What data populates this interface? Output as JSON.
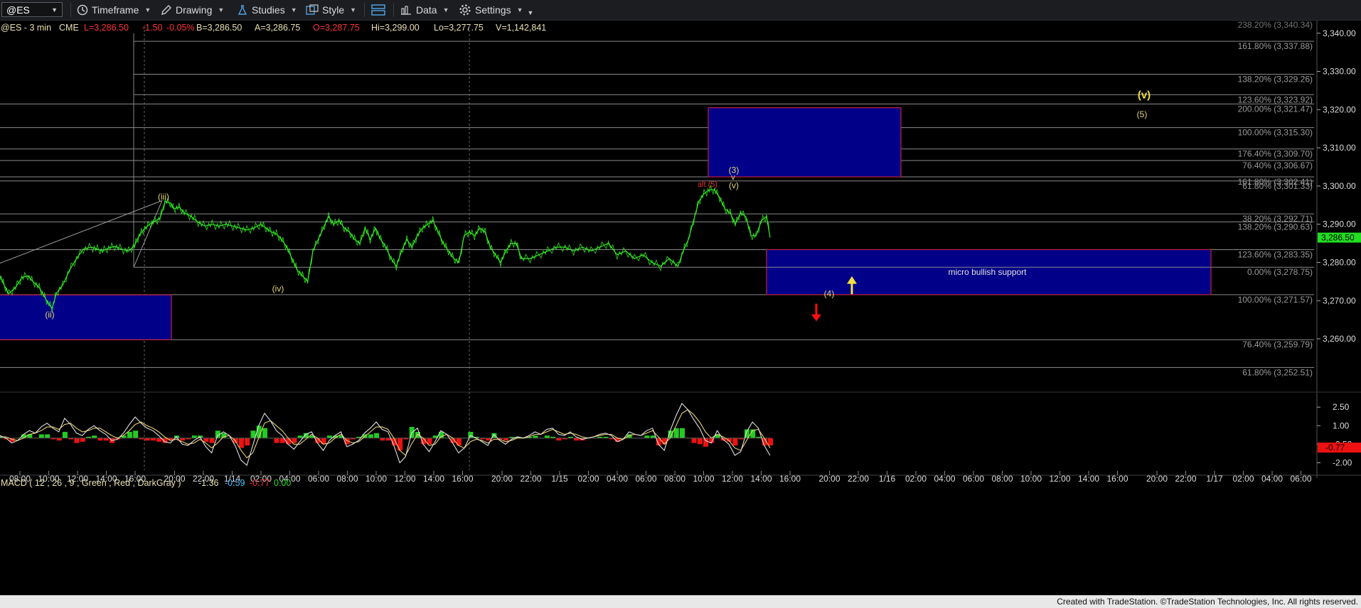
{
  "toolbar": {
    "symbol": "@ES",
    "timeframe_label": "Timeframe",
    "drawing_label": "Drawing",
    "studies_label": "Studies",
    "style_label": "Style",
    "data_label": "Data",
    "settings_label": "Settings"
  },
  "footer": {
    "text": "Created with TradeStation. ©TradeStation Technologies, Inc. All rights reserved."
  },
  "colors": {
    "price": "#33ee22",
    "box_fill": "#000088",
    "box_border": "#c02040",
    "label_yellow": "#e8d870",
    "label_bright_yellow": "#f0e040",
    "arrow_red": "#ff1010",
    "macd_line": "#e0e0e0",
    "signal_line": "#e8d070",
    "hist_up": "#22cc22",
    "hist_down": "#ee1111"
  },
  "chart_data": [
    {
      "type": "line",
      "header": {
        "title": "@ES - 3 min",
        "exchange": "CME",
        "last": "L=3,286.50",
        "change": "-1.50",
        "pct": "-0.05%",
        "bid": "B=3,286.50",
        "ask": "A=3,286.75",
        "open": "O=3,287.75",
        "high": "Hi=3,299.00",
        "low": "Lo=3,277.75",
        "volume": "V=1,142,841"
      },
      "ylim": [
        3247,
        3342
      ],
      "y_ticks": [
        3340,
        3330,
        3320,
        3310,
        3300,
        3290,
        3280,
        3270,
        3260
      ],
      "y_tick_labels": [
        "3,340.00",
        "3,330.00",
        "3,320.00",
        "3,310.00",
        "3,300.00",
        "3,290.00",
        "3,280.00",
        "3,270.00",
        "3,260.00"
      ],
      "last_price": 3286.5,
      "last_price_label": "3,286.50",
      "x_tick_labels": [
        "08:00",
        "10:00",
        "12:00",
        "14:00",
        "16:00",
        "20:00",
        "22:00",
        "1/14",
        "02:00",
        "04:00",
        "06:00",
        "08:00",
        "10:00",
        "12:00",
        "14:00",
        "16:00",
        "20:00",
        "22:00",
        "1/15",
        "02:00",
        "04:00",
        "06:00",
        "08:00",
        "10:00",
        "12:00",
        "14:00",
        "16:00",
        "20:00",
        "22:00",
        "1/16",
        "02:00",
        "04:00",
        "06:00",
        "08:00",
        "10:00",
        "12:00",
        "14:00",
        "16:00",
        "20:00",
        "22:00",
        "1/17",
        "02:00",
        "04:00",
        "06:00"
      ],
      "price_series": {
        "name": "",
        "x": [
          0,
          5,
          10,
          18,
          25,
          32,
          38,
          45,
          50,
          55,
          60,
          65,
          72,
          80,
          88,
          96,
          105,
          112,
          118,
          125,
          132,
          140,
          148,
          155,
          160,
          165,
          172,
          178,
          184,
          190,
          196,
          200,
          206,
          212,
          220,
          228,
          236,
          244,
          252,
          260,
          268,
          276,
          284,
          292,
          300,
          306,
          312,
          318,
          324,
          330,
          336,
          342,
          348,
          354,
          360,
          366,
          372,
          378,
          384,
          390,
          396,
          402,
          408,
          414,
          420,
          426,
          432,
          438,
          444,
          450,
          456,
          462,
          468,
          474,
          480,
          486,
          492,
          498,
          504,
          510,
          516,
          522,
          528,
          534,
          540,
          546,
          552,
          558,
          564,
          570,
          576,
          582,
          588,
          594,
          600,
          610,
          620,
          630,
          640,
          650,
          660,
          670,
          680,
          690,
          700,
          710,
          720,
          730,
          740,
          750,
          760,
          770,
          780,
          786,
          792,
          798,
          804,
          810,
          816,
          822,
          828,
          834,
          840,
          846,
          852,
          858,
          864,
          870,
          876,
          882,
          886
        ],
        "values": [
          3276.5,
          3274,
          3271.8,
          3273.5,
          3276,
          3276.5,
          3275,
          3273.5,
          3271.5,
          3269.5,
          3268,
          3272,
          3274,
          3278,
          3281,
          3283.5,
          3284,
          3283.5,
          3283,
          3283.8,
          3284.2,
          3283.5,
          3283,
          3284.5,
          3287,
          3288.5,
          3290,
          3290.8,
          3291.5,
          3296,
          3295.5,
          3294,
          3294.5,
          3293,
          3292,
          3290.5,
          3289.5,
          3290,
          3289.5,
          3290,
          3289.5,
          3289,
          3288.5,
          3289,
          3290,
          3289,
          3288,
          3287.5,
          3286,
          3284,
          3281,
          3278,
          3276.5,
          3275,
          3283,
          3286,
          3289,
          3292,
          3290,
          3291,
          3289,
          3288,
          3286,
          3285,
          3289,
          3286,
          3289,
          3286,
          3284,
          3281,
          3279,
          3283,
          3286,
          3284,
          3287,
          3289,
          3290,
          3291,
          3288,
          3285,
          3283,
          3281,
          3280,
          3287,
          3288,
          3287,
          3289,
          3288,
          3284,
          3282,
          3280,
          3283,
          3285,
          3285,
          3281,
          3281,
          3282,
          3283,
          3284,
          3284,
          3283,
          3284,
          3283,
          3284,
          3285,
          3282,
          3283,
          3281,
          3282,
          3280,
          3279,
          3281,
          3279,
          3283,
          3286,
          3291,
          3296,
          3298,
          3299,
          3299,
          3297,
          3294,
          3293,
          3290,
          3293,
          3292,
          3287,
          3287,
          3291,
          3292,
          3286.5
        ]
      },
      "fib_levels": [
        {
          "label": "161.80% (3,337.88)",
          "value": 3337.88
        },
        {
          "label": "138.20% (3,329.26)",
          "value": 3329.26
        },
        {
          "label": "123.60% (3,323.92)",
          "value": 3323.92
        },
        {
          "label": "200.00% (3,321.47)",
          "value": 3321.47
        },
        {
          "label": "100.00% (3,315.30)",
          "value": 3315.3
        },
        {
          "label": "176.40% (3,309.70)",
          "value": 3309.7
        },
        {
          "label": "76.40% (3,306.67)",
          "value": 3306.67
        },
        {
          "label": "161.80% (3,302.41)",
          "value": 3302.41
        },
        {
          "label": "61.80% (3,301.33)",
          "value": 3301.33
        },
        {
          "label": "38.20% (3,292.71)",
          "value": 3292.71
        },
        {
          "label": "138.20% (3,290.63)",
          "value": 3290.63
        },
        {
          "label": "123.60% (3,283.35)",
          "value": 3283.35
        },
        {
          "label": "0.00% (3,278.75)",
          "value": 3278.75
        },
        {
          "label": "100.00% (3,271.57)",
          "value": 3271.57
        },
        {
          "label": "76.40% (3,259.79)",
          "value": 3259.79
        },
        {
          "label": "61.80% (3,252.51)",
          "value": 3252.51
        }
      ],
      "top_partial_label": "238.20% (3,340.34)",
      "boxes": [
        {
          "name": "target-box-upper",
          "y_top": 3320.5,
          "y_bottom": 3302.4,
          "label": ""
        },
        {
          "name": "micro-bullish-support-box",
          "y_top": 3283.35,
          "y_bottom": 3271.57,
          "label": "micro bullish support"
        },
        {
          "name": "support-box-lower",
          "y_top": 3271.5,
          "y_bottom": 3259.79,
          "label": ""
        }
      ],
      "wave_labels": [
        {
          "text": "(iii)",
          "value": 3297.2,
          "color": "yellow"
        },
        {
          "text": "(ii)",
          "value": 3266.3,
          "color": "yellow"
        },
        {
          "text": "(iv)",
          "value": 3273.1,
          "color": "yellow"
        },
        {
          "text": "alt (5)",
          "value": 3300.5,
          "color": "red"
        },
        {
          "text": "(3)",
          "value": 3304.2,
          "color": "yellow"
        },
        {
          "text": "v",
          "value": 3302.4,
          "color": "yellow"
        },
        {
          "text": "(v)",
          "value": 3300.2,
          "color": "yellow"
        },
        {
          "text": "(4)",
          "value": 3271.8,
          "color": "yellow"
        },
        {
          "text": "(v)",
          "value": 3323.7,
          "color": "bright"
        },
        {
          "text": "(5)",
          "value": 3318.8,
          "color": "yellow"
        }
      ]
    },
    {
      "type": "line",
      "title": "MACD ( 12 , 26 , 9 , Green , Red , DarkGray )",
      "values_shown": [
        "-1.36",
        "-0.59",
        "-0.77",
        "0.00"
      ],
      "ylim": [
        -2.6,
        3.2
      ],
      "y_tick_labels": [
        "2.50",
        "1.00",
        "-0.50",
        "-2.00"
      ],
      "y_ticks": [
        2.5,
        1.0,
        -0.5,
        -2.0
      ],
      "last_value_label": "-0.77",
      "series": [
        {
          "name": "MACD",
          "values": [
            0.2,
            0.0,
            -0.4,
            -0.2,
            0.3,
            0.6,
            0.4,
            0.9,
            1.2,
            0.8,
            0.5,
            1.6,
            1.1,
            0.4,
            0.2,
            0.7,
            1.0,
            0.6,
            0.3,
            -0.2,
            -0.1,
            0.4,
            1.1,
            1.7,
            1.2,
            0.8,
            0.6,
            0.2,
            -0.3,
            -0.4,
            0.1,
            -0.5,
            -0.6,
            -0.2,
            0.1,
            -0.7,
            -1.2,
            0.2,
            0.5,
            0.2,
            -0.6,
            -1.8,
            -2.2,
            -0.6,
            1.0,
            2.0,
            1.4,
            0.6,
            0.2,
            -0.5,
            -0.9,
            -0.3,
            0.3,
            0.5,
            -0.4,
            -1.0,
            -0.2,
            0.2,
            0.5,
            -0.7,
            -0.5,
            -0.2,
            0.4,
            0.8,
            1.3,
            0.7,
            0.5,
            -0.6,
            -2.0,
            -1.5,
            0.4,
            0.8,
            -0.5,
            -1.1,
            -0.3,
            0.6,
            0.3,
            -0.4,
            -1.2,
            -0.8,
            0.2,
            0.0,
            -0.3,
            -0.6,
            0.3,
            -0.2,
            -0.5,
            -0.1,
            0.1,
            0.0,
            0.2,
            0.5,
            0.3,
            0.7,
            0.8,
            0.3,
            0.2,
            0.5,
            0.1,
            -0.1,
            0.0,
            0.1,
            0.3,
            0.4,
            0.2,
            -0.3,
            -0.1,
            0.5,
            0.3,
            0.2,
            0.6,
            0.8,
            -0.5,
            -1.0,
            0.6,
            1.8,
            2.8,
            2.3,
            1.5,
            0.8,
            -0.2,
            -0.4,
            0.6,
            -0.1,
            -0.5,
            -1.4,
            -1.1,
            0.5,
            1.3,
            0.8,
            -0.6,
            -1.4
          ]
        },
        {
          "name": "Signal",
          "values": [
            0.1,
            0.1,
            -0.1,
            -0.2,
            0.0,
            0.3,
            0.4,
            0.6,
            0.9,
            0.9,
            0.7,
            1.1,
            1.2,
            0.8,
            0.5,
            0.6,
            0.8,
            0.8,
            0.5,
            0.2,
            0.0,
            0.2,
            0.6,
            1.1,
            1.3,
            1.0,
            0.8,
            0.5,
            0.1,
            -0.2,
            -0.1,
            -0.3,
            -0.5,
            -0.4,
            -0.1,
            -0.4,
            -0.8,
            -0.4,
            0.1,
            0.2,
            -0.2,
            -1.0,
            -1.6,
            -1.2,
            0.0,
            1.2,
            1.4,
            1.0,
            0.6,
            0.0,
            -0.5,
            -0.5,
            -0.1,
            0.3,
            0.0,
            -0.5,
            -0.4,
            0.0,
            0.3,
            -0.2,
            -0.4,
            -0.3,
            0.1,
            0.5,
            0.9,
            0.9,
            0.7,
            0.0,
            -1.0,
            -1.4,
            -0.5,
            0.3,
            0.0,
            -0.6,
            -0.5,
            0.1,
            0.3,
            0.0,
            -0.6,
            -0.8,
            -0.3,
            -0.1,
            -0.2,
            -0.4,
            -0.1,
            -0.1,
            -0.3,
            -0.2,
            0.0,
            0.0,
            0.1,
            0.3,
            0.3,
            0.5,
            0.7,
            0.5,
            0.3,
            0.4,
            0.3,
            0.1,
            0.0,
            0.1,
            0.2,
            0.3,
            0.3,
            0.0,
            -0.1,
            0.2,
            0.3,
            0.2,
            0.4,
            0.6,
            0.1,
            -0.5,
            0.0,
            1.0,
            2.0,
            2.3,
            1.9,
            1.3,
            0.5,
            0.0,
            0.3,
            0.1,
            -0.2,
            -0.8,
            -1.0,
            -0.2,
            0.6,
            0.7,
            0.0,
            -0.8
          ]
        },
        {
          "name": "Histogram",
          "values": [
            0.1,
            -0.1,
            -0.3,
            0.0,
            0.3,
            0.3,
            0.0,
            0.3,
            0.3,
            -0.1,
            -0.2,
            0.5,
            -0.1,
            -0.4,
            -0.3,
            0.1,
            0.2,
            -0.2,
            -0.2,
            -0.4,
            -0.1,
            0.2,
            0.5,
            0.6,
            -0.1,
            -0.2,
            -0.2,
            -0.3,
            -0.4,
            -0.2,
            0.2,
            -0.2,
            -0.1,
            0.2,
            0.2,
            -0.3,
            -0.4,
            0.6,
            0.4,
            0.0,
            -0.4,
            -0.8,
            -0.6,
            0.6,
            1.0,
            0.8,
            0.0,
            -0.4,
            -0.4,
            -0.5,
            -0.4,
            0.2,
            0.4,
            0.2,
            -0.4,
            -0.5,
            0.2,
            0.2,
            0.2,
            -0.5,
            -0.1,
            0.1,
            0.3,
            0.3,
            0.4,
            -0.2,
            -0.2,
            -0.6,
            -1.0,
            -0.1,
            0.9,
            0.5,
            -0.5,
            -0.5,
            0.2,
            0.5,
            0.0,
            -0.4,
            -0.6,
            0.0,
            0.5,
            0.1,
            -0.1,
            -0.2,
            0.4,
            -0.1,
            -0.2,
            0.1,
            0.1,
            0.0,
            0.1,
            0.2,
            0.0,
            0.2,
            0.1,
            -0.2,
            -0.1,
            0.1,
            -0.2,
            -0.2,
            0.0,
            0.0,
            0.1,
            0.1,
            -0.1,
            -0.3,
            0.0,
            0.3,
            0.0,
            0.0,
            0.2,
            0.2,
            -0.6,
            -0.5,
            0.6,
            0.8,
            0.8,
            0.0,
            -0.4,
            -0.5,
            -0.7,
            -0.4,
            0.3,
            -0.2,
            -0.3,
            -0.6,
            -0.1,
            0.7,
            0.7,
            0.1,
            -0.6,
            -0.6
          ]
        }
      ]
    }
  ]
}
